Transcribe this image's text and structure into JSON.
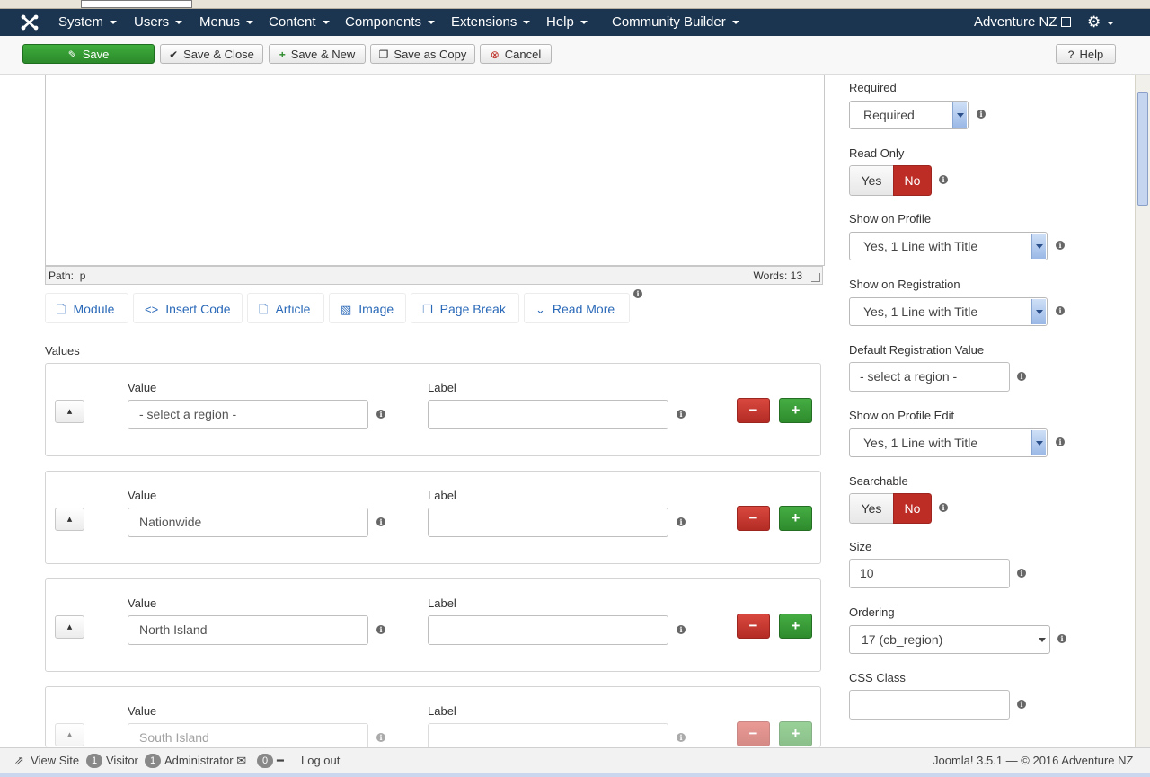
{
  "navbar": {
    "items": [
      "System",
      "Users",
      "Menus",
      "Content",
      "Components",
      "Extensions",
      "Help",
      "Community Builder"
    ],
    "site_name": "Adventure NZ"
  },
  "toolbar": {
    "save": "Save",
    "save_close": "Save & Close",
    "save_new": "Save & New",
    "save_copy": "Save as Copy",
    "cancel": "Cancel",
    "help": "Help"
  },
  "editor": {
    "path_label": "Path:",
    "path_value": "p",
    "words": "Words: 13",
    "buttons": [
      "Module",
      "Insert Code",
      "Article",
      "Image",
      "Page Break",
      "Read More"
    ]
  },
  "values_section": {
    "title": "Values",
    "value_label": "Value",
    "label_label": "Label",
    "rows": [
      {
        "value": "- select a region -",
        "label": ""
      },
      {
        "value": "Nationwide",
        "label": ""
      },
      {
        "value": "North Island",
        "label": ""
      },
      {
        "value": "South Island",
        "label": ""
      }
    ]
  },
  "right_panel": {
    "required_label": "Required",
    "required_value": "Required",
    "read_only_label": "Read Only",
    "yes": "Yes",
    "no": "No",
    "show_profile_label": "Show on Profile",
    "show_profile_value": "Yes, 1 Line with Title",
    "show_registration_label": "Show on Registration",
    "show_registration_value": "Yes, 1 Line with Title",
    "default_reg_label": "Default Registration Value",
    "default_reg_value": "- select a region -",
    "show_profile_edit_label": "Show on Profile Edit",
    "show_profile_edit_value": "Yes, 1 Line with Title",
    "searchable_label": "Searchable",
    "size_label": "Size",
    "size_value": "10",
    "ordering_label": "Ordering",
    "ordering_value": "17 (cb_region)",
    "css_class_label": "CSS Class",
    "css_class_value": ""
  },
  "footer": {
    "view_site": "View Site",
    "visitor_count": "1",
    "visitor_label": "Visitor",
    "admin_count": "1",
    "admin_label": "Administrator",
    "messages_count": "0",
    "logout": "Log out",
    "version": "Joomla! 3.5.1 — © 2016 Adventure NZ"
  },
  "colors": {
    "navbar": "#1b3550",
    "save_green": "#2c8a2b",
    "remove_red": "#bd2c25",
    "link_blue": "#2a69b8"
  }
}
